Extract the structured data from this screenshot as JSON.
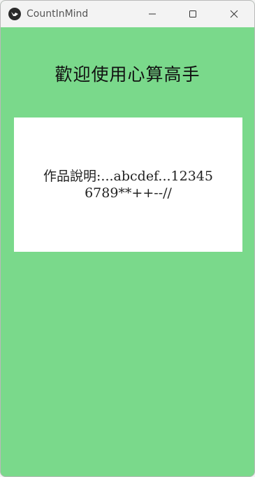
{
  "window": {
    "title": "CountInMind",
    "icon": "kivy-logo-icon",
    "controls": {
      "minimize": "minimize-icon",
      "maximize": "maximize-icon",
      "close": "close-icon"
    }
  },
  "main": {
    "welcome_text": "歡迎使用心算高手",
    "description": "作品說明:...abcdef...123456789**++--//"
  },
  "colors": {
    "background": "#7ad98b",
    "card": "#ffffff",
    "titlebar": "#f3f3f3"
  }
}
